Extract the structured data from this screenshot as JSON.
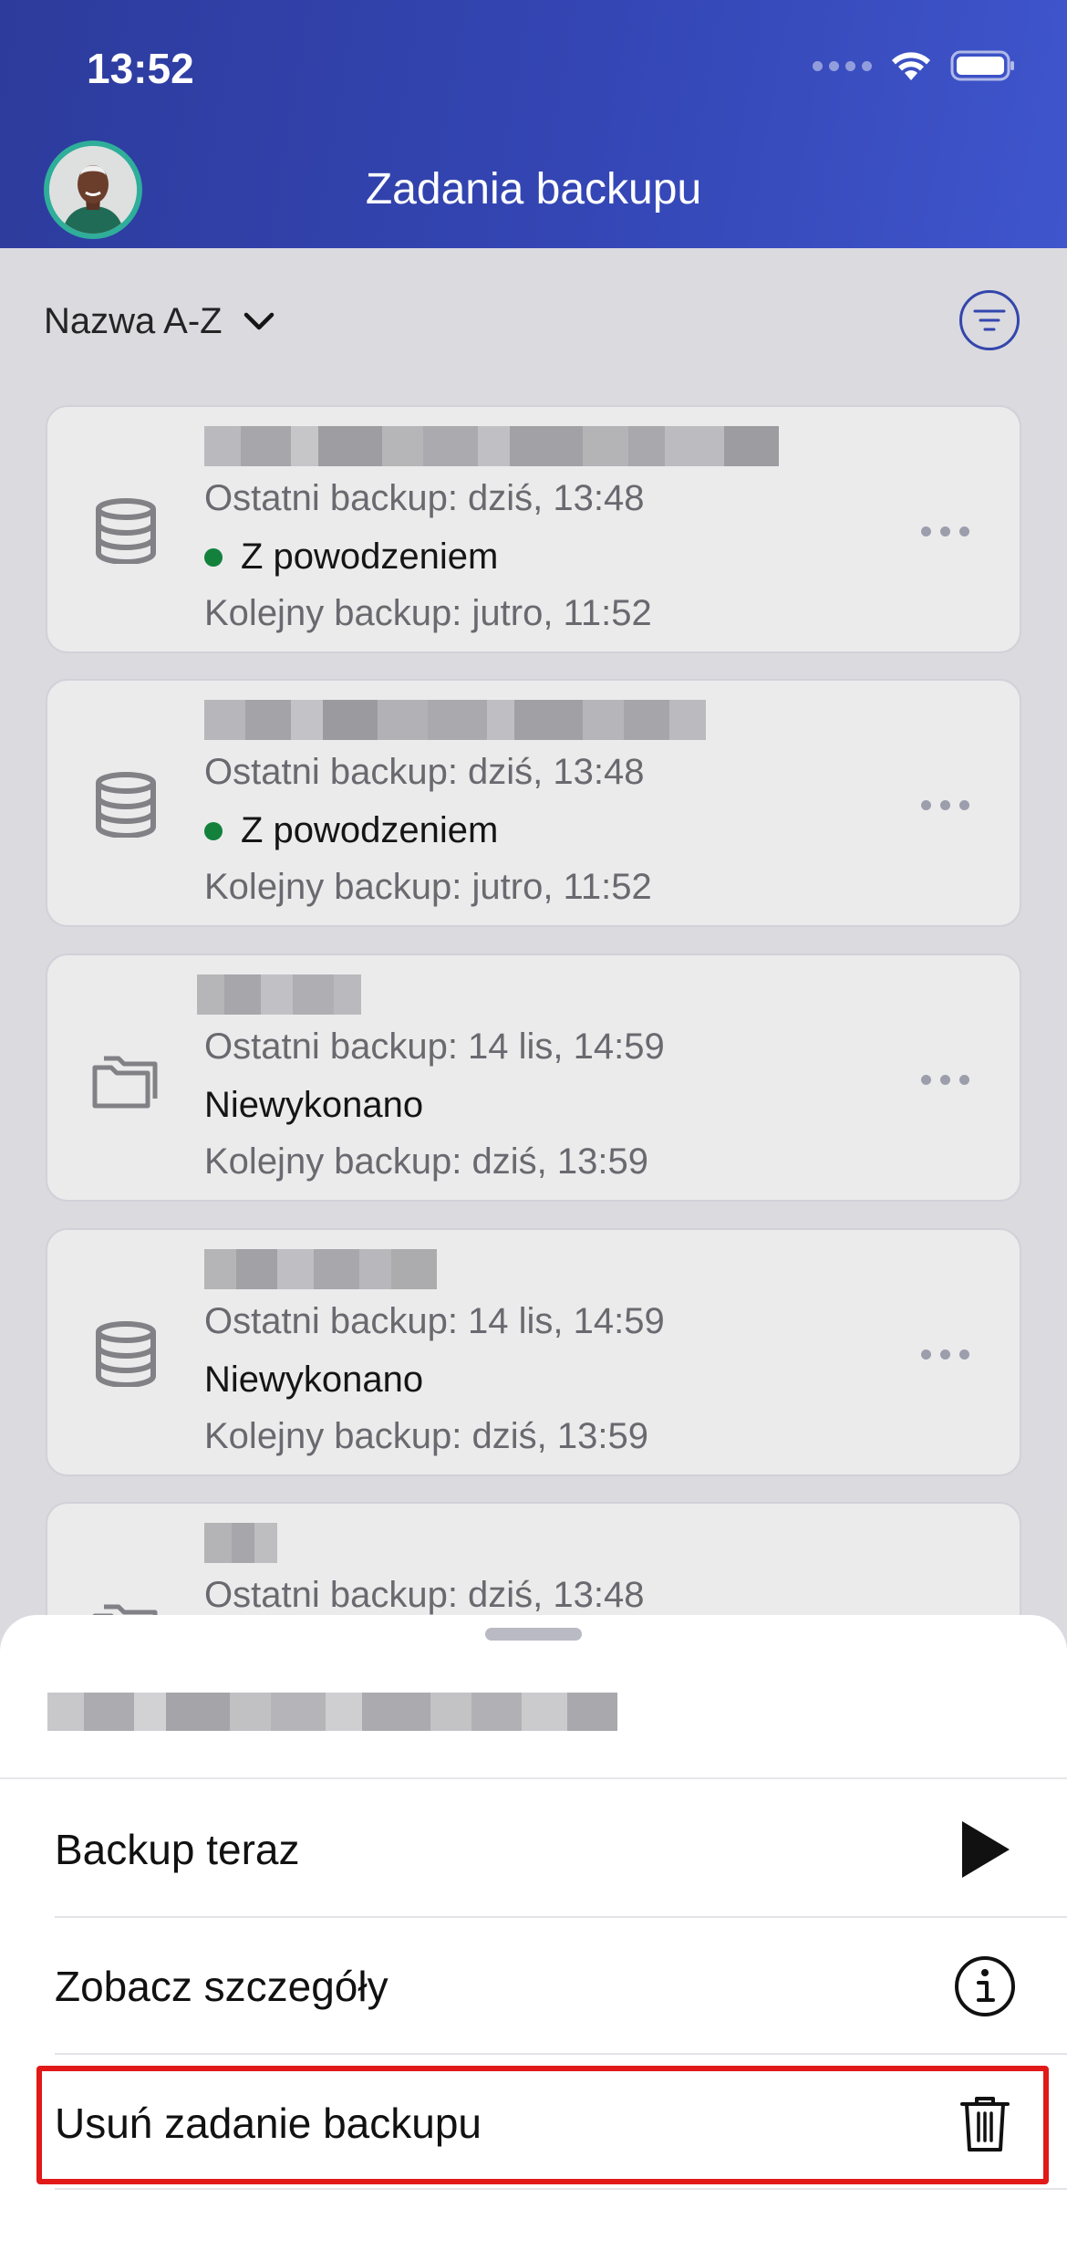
{
  "status_bar": {
    "time": "13:52"
  },
  "header": {
    "title": "Zadania backupu"
  },
  "sort": {
    "label": "Nazwa A-Z"
  },
  "jobs": [
    {
      "icon": "database-icon",
      "name_redacted": true,
      "last_backup": "Ostatni backup: dziś, 13:48",
      "status": "Z powodzeniem",
      "status_color": "#0f8a3c",
      "next_backup": "Kolejny backup: jutro, 11:52"
    },
    {
      "icon": "database-icon",
      "name_redacted": true,
      "last_backup": "Ostatni backup: dziś, 13:48",
      "status": "Z powodzeniem",
      "status_color": "#0f8a3c",
      "next_backup": "Kolejny backup: jutro, 11:52"
    },
    {
      "icon": "folder-icon",
      "name_redacted": true,
      "last_backup": "Ostatni backup: 14 lis, 14:59",
      "status": "Niewykonano",
      "next_backup": "Kolejny backup: dziś, 13:59"
    },
    {
      "icon": "database-icon",
      "name_redacted": true,
      "last_backup": "Ostatni backup: 14 lis, 14:59",
      "status": "Niewykonano",
      "next_backup": "Kolejny backup: dziś, 13:59"
    },
    {
      "icon": "folder-icon",
      "name_redacted": true,
      "last_backup": "Ostatni backup: dziś, 13:48"
    }
  ],
  "sheet": {
    "title_redacted": true,
    "actions": [
      {
        "label": "Backup teraz",
        "icon": "play-icon"
      },
      {
        "label": "Zobacz szczegóły",
        "icon": "info-icon"
      },
      {
        "label": "Usuń zadanie backupu",
        "icon": "trash-icon",
        "highlighted": true
      }
    ]
  },
  "colors": {
    "header_gradient_start": "#2d3b9c",
    "header_gradient_end": "#3f55cc",
    "accent": "#3448b8",
    "success": "#0f8a3c",
    "highlight_border": "#e11919"
  }
}
